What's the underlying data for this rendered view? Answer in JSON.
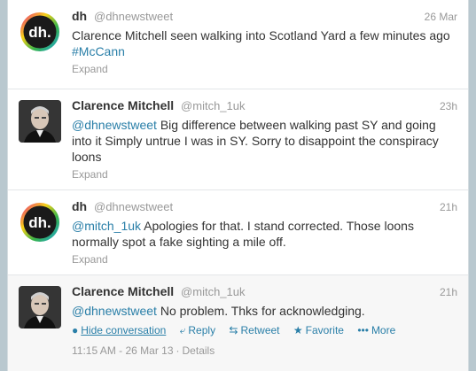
{
  "tweets": [
    {
      "fullname": "dh",
      "username": "@dhnewstweet",
      "time": "26 Mar",
      "text": [
        {
          "t": "Clarence Mitchell seen walking into Scotland Yard a few minutes ago ",
          "link": false
        },
        {
          "t": "#McCann",
          "link": true
        }
      ],
      "expand": "Expand"
    },
    {
      "fullname": "Clarence Mitchell",
      "username": "@mitch_1uk",
      "time": "23h",
      "text": [
        {
          "t": "@dhnewstweet",
          "link": true
        },
        {
          "t": " Big difference between walking past SY and going into it Simply untrue I was in SY. Sorry to disappoint the conspiracy loons",
          "link": false
        }
      ],
      "expand": "Expand"
    },
    {
      "fullname": "dh",
      "username": "@dhnewstweet",
      "time": "21h",
      "text": [
        {
          "t": "@mitch_1uk",
          "link": true
        },
        {
          "t": " Apologies for that. I stand corrected. Those loons normally spot a fake sighting a mile off.",
          "link": false
        }
      ],
      "expand": "Expand"
    },
    {
      "fullname": "Clarence Mitchell",
      "username": "@mitch_1uk",
      "time": "21h",
      "text": [
        {
          "t": "@dhnewstweet",
          "link": true
        },
        {
          "t": " No problem. Thks for acknowledging.",
          "link": false
        }
      ]
    }
  ],
  "actions": {
    "hide": "Hide conversation",
    "reply": "Reply",
    "retweet": "Retweet",
    "favorite": "Favorite",
    "more": "More"
  },
  "meta": {
    "timestamp": "11:15 AM - 26 Mar 13",
    "details": "Details"
  },
  "colors": {
    "link": "#2a7fa8",
    "muted": "#999999",
    "background": "#b9c8cf"
  },
  "avatars": {
    "dh_logo_text": "dh."
  }
}
